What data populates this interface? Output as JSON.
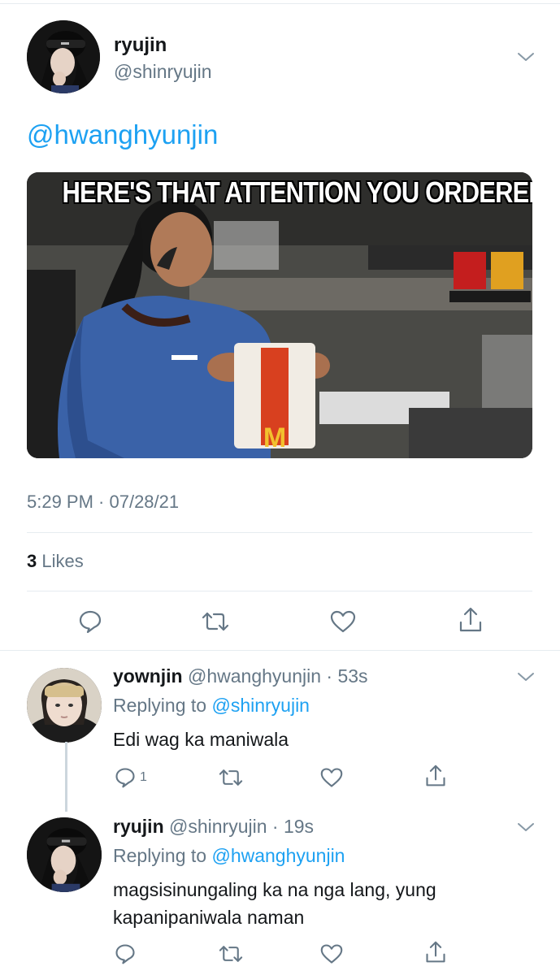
{
  "main_tweet": {
    "name": "ryujin",
    "handle": "@shinryujin",
    "text_mention": "@hwanghyunjin",
    "media_caption": "HERE'S THAT ATTENTION YOU ORDERED",
    "timestamp": "5:29 PM · 07/28/21",
    "likes_count": "3",
    "likes_label": " Likes"
  },
  "replies": [
    {
      "name": "yownjin",
      "handle_time": " @hwanghyunjin · 53s",
      "replying_prefix": "Replying to ",
      "replying_to": "@shinryujin",
      "text": "Edi wag ka maniwala",
      "reply_count": "1"
    },
    {
      "name": "ryujin",
      "handle_time": " @shinryujin · 19s",
      "replying_prefix": "Replying to ",
      "replying_to": "@hwanghyunjin",
      "text_line1": "magsisinungaling ka na nga lang, yung",
      "text_line2": "kapanipaniwala naman"
    }
  ],
  "icons": {
    "reply": "reply-icon",
    "retweet": "retweet-icon",
    "like": "heart-icon",
    "share": "share-icon",
    "menu": "chevron-down-icon"
  },
  "colors": {
    "accent": "#1da1f2",
    "secondary_text": "#657786",
    "divider": "#e6ecf0"
  }
}
